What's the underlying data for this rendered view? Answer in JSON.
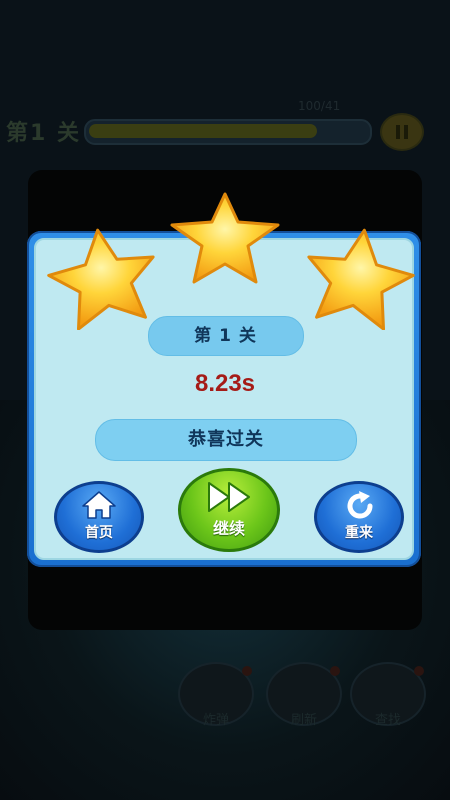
{
  "hud": {
    "level_text": "第1 关",
    "score_text": "100/41",
    "progress_fraction": 0.82
  },
  "dialog": {
    "stars_earned": 3,
    "stars_total": 3,
    "level_prefix": "第",
    "level_number": "1",
    "level_suffix": "关",
    "time": "8.23s",
    "message": "恭喜过关",
    "home_label": "首页",
    "continue_label": "继续",
    "retry_label": "重来"
  },
  "tools": [
    {
      "label": "炸弹"
    },
    {
      "label": "刷新"
    },
    {
      "label": "查找"
    }
  ],
  "colors": {
    "panel_border": "#1a6fd0",
    "panel_fill": "#bfe9f1",
    "time_red": "#a51b17",
    "button_blue": "#1f6fd6",
    "button_green": "#6cc61a",
    "star_gold": "#f7b81c"
  }
}
